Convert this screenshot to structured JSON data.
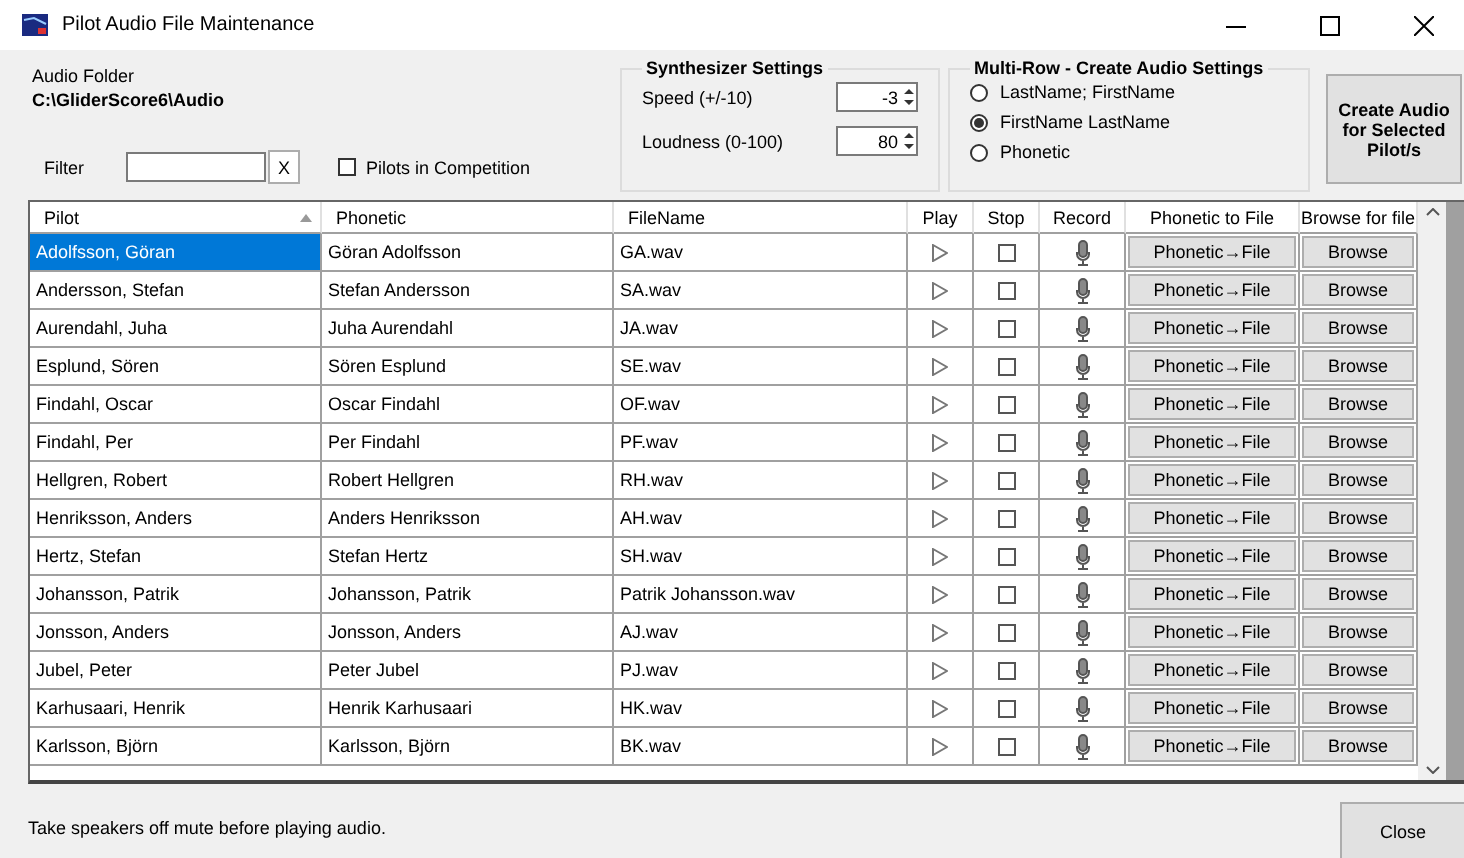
{
  "window": {
    "title": "Pilot Audio File Maintenance"
  },
  "audio_folder": {
    "label": "Audio Folder",
    "path": "C:\\GliderScore6\\Audio"
  },
  "filter": {
    "label": "Filter",
    "clear_button": "X"
  },
  "pilots_in_competition": {
    "label": "Pilots in Competition",
    "checked": false
  },
  "synthesizer": {
    "title": "Synthesizer Settings",
    "fields": [
      {
        "label": "Speed (+/-10)",
        "value": "-3"
      },
      {
        "label": "Loudness (0-100)",
        "value": "80"
      }
    ]
  },
  "multi_row": {
    "title": "Multi-Row - Create Audio Settings",
    "options": [
      {
        "label": "LastName; FirstName",
        "selected": false
      },
      {
        "label": "FirstName LastName",
        "selected": true
      },
      {
        "label": "Phonetic",
        "selected": false
      }
    ]
  },
  "create_button": "Create Audio for Selected Pilot/s",
  "table": {
    "columns": [
      "Pilot",
      "Phonetic",
      "FileName",
      "Play",
      "Stop",
      "Record",
      "Phonetic to File",
      "Browse for file"
    ],
    "rows": [
      {
        "pilot": "Adolfsson, Göran",
        "phonetic": "Göran Adolfsson",
        "file": "GA.wav",
        "stop": false,
        "to_file": "Phonetic→File",
        "browse": "Browse",
        "selected": true
      },
      {
        "pilot": "Andersson, Stefan",
        "phonetic": "Stefan Andersson",
        "file": "SA.wav",
        "stop": false,
        "to_file": "Phonetic→File",
        "browse": "Browse",
        "selected": false
      },
      {
        "pilot": "Aurendahl, Juha",
        "phonetic": "Juha Aurendahl",
        "file": "JA.wav",
        "stop": false,
        "to_file": "Phonetic→File",
        "browse": "Browse",
        "selected": false
      },
      {
        "pilot": "Esplund, Sören",
        "phonetic": "Sören Esplund",
        "file": "SE.wav",
        "stop": false,
        "to_file": "Phonetic→File",
        "browse": "Browse",
        "selected": false
      },
      {
        "pilot": "Findahl, Oscar",
        "phonetic": "Oscar Findahl",
        "file": "OF.wav",
        "stop": false,
        "to_file": "Phonetic→File",
        "browse": "Browse",
        "selected": false
      },
      {
        "pilot": "Findahl, Per",
        "phonetic": "Per Findahl",
        "file": "PF.wav",
        "stop": false,
        "to_file": "Phonetic→File",
        "browse": "Browse",
        "selected": false
      },
      {
        "pilot": "Hellgren, Robert",
        "phonetic": "Robert Hellgren",
        "file": "RH.wav",
        "stop": false,
        "to_file": "Phonetic→File",
        "browse": "Browse",
        "selected": false
      },
      {
        "pilot": "Henriksson, Anders",
        "phonetic": "Anders Henriksson",
        "file": "AH.wav",
        "stop": false,
        "to_file": "Phonetic→File",
        "browse": "Browse",
        "selected": false
      },
      {
        "pilot": "Hertz, Stefan",
        "phonetic": "Stefan Hertz",
        "file": "SH.wav",
        "stop": false,
        "to_file": "Phonetic→File",
        "browse": "Browse",
        "selected": false
      },
      {
        "pilot": "Johansson, Patrik",
        "phonetic": "Johansson, Patrik",
        "file": "Patrik Johansson.wav",
        "stop": false,
        "to_file": "Phonetic→File",
        "browse": "Browse",
        "selected": false
      },
      {
        "pilot": "Jonsson, Anders",
        "phonetic": "Jonsson, Anders",
        "file": "AJ.wav",
        "stop": false,
        "to_file": "Phonetic→File",
        "browse": "Browse",
        "selected": false
      },
      {
        "pilot": "Jubel, Peter",
        "phonetic": "Peter Jubel",
        "file": "PJ.wav",
        "stop": false,
        "to_file": "Phonetic→File",
        "browse": "Browse",
        "selected": false
      },
      {
        "pilot": "Karhusaari, Henrik",
        "phonetic": "Henrik Karhusaari",
        "file": "HK.wav",
        "stop": false,
        "to_file": "Phonetic→File",
        "browse": "Browse",
        "selected": false
      },
      {
        "pilot": "Karlsson, Björn",
        "phonetic": "Karlsson, Björn",
        "file": "BK.wav",
        "stop": false,
        "to_file": "Phonetic→File",
        "browse": "Browse",
        "selected": false
      }
    ]
  },
  "status_message": "Take speakers off mute before playing audio.",
  "close_button": "Close"
}
